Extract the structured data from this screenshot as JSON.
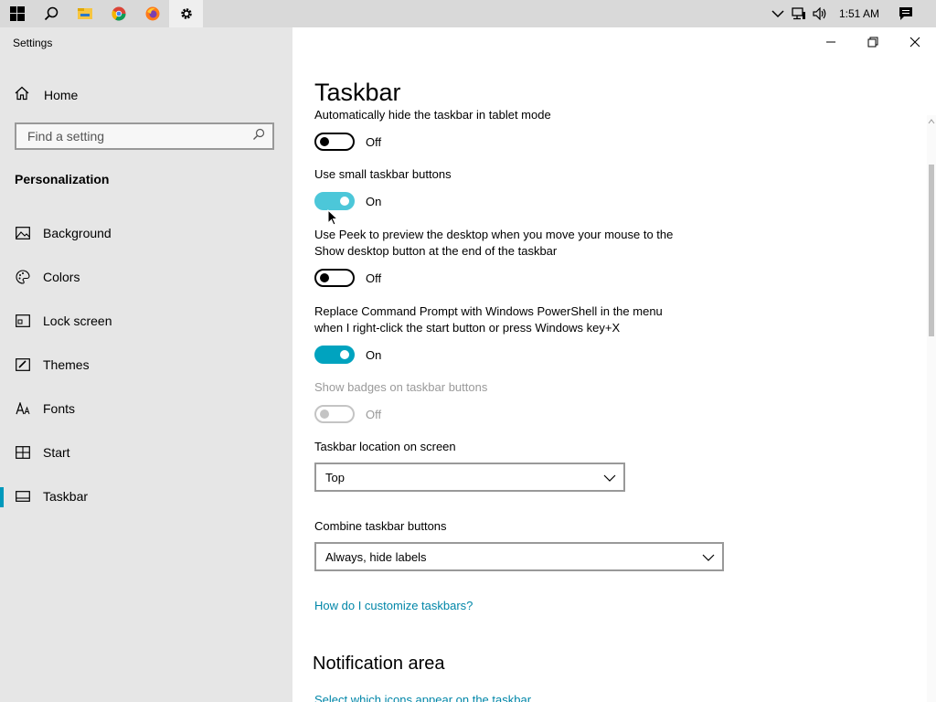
{
  "taskbar": {
    "clock": "1:51 AM",
    "icons": [
      "windows-start-icon",
      "search-icon",
      "file-explorer-icon",
      "chrome-icon",
      "firefox-icon",
      "settings-gear-icon"
    ],
    "tray_icons": [
      "chevron-up-icon",
      "network-icon",
      "volume-icon",
      "action-center-icon"
    ]
  },
  "app": {
    "title": "Settings"
  },
  "sidebar": {
    "home_label": "Home",
    "search_placeholder": "Find a setting",
    "section": "Personalization",
    "items": [
      {
        "label": "Background",
        "icon": "picture-icon"
      },
      {
        "label": "Colors",
        "icon": "palette-icon"
      },
      {
        "label": "Lock screen",
        "icon": "lock-screen-icon"
      },
      {
        "label": "Themes",
        "icon": "brush-icon"
      },
      {
        "label": "Fonts",
        "icon": "font-icon"
      },
      {
        "label": "Start",
        "icon": "start-icon"
      },
      {
        "label": "Taskbar",
        "icon": "taskbar-icon",
        "selected": true
      }
    ]
  },
  "main": {
    "title": "Taskbar",
    "settings": [
      {
        "label": "Automatically hide the taskbar in tablet mode",
        "state": "Off"
      },
      {
        "label": "Use small taskbar buttons",
        "state": "On"
      },
      {
        "label_line1": "Use Peek to preview the desktop when you move your mouse to the",
        "label_line2": "Show desktop button at the end of the taskbar",
        "state": "Off"
      },
      {
        "label_line1": "Replace Command Prompt with Windows PowerShell in the menu",
        "label_line2": "when I right-click the start button or press Windows key+X",
        "state": "On"
      },
      {
        "label": "Show badges on taskbar buttons",
        "state": "Off",
        "disabled": true
      }
    ],
    "location": {
      "label": "Taskbar location on screen",
      "value": "Top"
    },
    "combine": {
      "label": "Combine taskbar buttons",
      "value": "Always, hide labels"
    },
    "help_link": "How do I customize taskbars?",
    "notification_heading": "Notification area",
    "notification_link": "Select which icons appear on the taskbar"
  },
  "colors": {
    "accent": "#00a3bf",
    "link": "#0086a8",
    "sidebar_bg": "#e6e6e6",
    "taskbar_bg": "#d9d9d9"
  }
}
